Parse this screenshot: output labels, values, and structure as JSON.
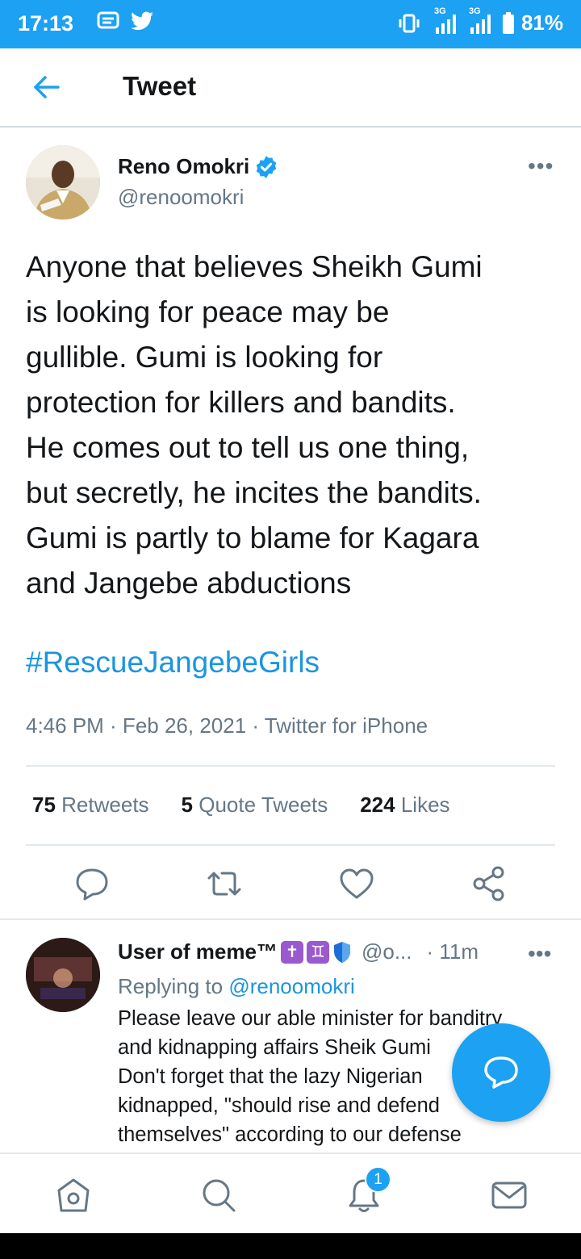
{
  "status_bar": {
    "time": "17:13",
    "battery": "81%",
    "network_1": "3G",
    "network_2": "3G"
  },
  "header": {
    "title": "Tweet"
  },
  "tweet": {
    "author_name": "Reno Omokri",
    "author_handle": "@renoomokri",
    "verified": true,
    "text": "Anyone that believes Sheikh Gumi\nis looking for peace may be\ngullible. Gumi is looking for\nprotection for killers and bandits.\nHe comes out to tell us one thing,\nbut secretly, he incites the bandits.\nGumi is partly to blame for Kagara\nand Jangebe abductions",
    "hashtag": "#RescueJangebeGirls",
    "meta": "4:46 PM · Feb 26, 2021 · Twitter for iPhone",
    "stats": {
      "retweets_count": "75",
      "retweets_label": "Retweets",
      "quotes_count": "5",
      "quotes_label": "Quote Tweets",
      "likes_count": "224",
      "likes_label": "Likes"
    }
  },
  "reply": {
    "author_name": "User of meme™",
    "handle": "@o...",
    "time": "· 11m",
    "replying_prefix": "Replying to",
    "replying_to": "@renoomokri",
    "text": "Please leave our able minister for banditry\nand kidnapping affairs Sheik Gumi\nDon't forget that the lazy Nigerian\nkidnapped, \"should rise and defend\nthemselves\" according to our defense"
  },
  "bottom_nav": {
    "notification_count": "1"
  },
  "colors": {
    "accent": "#1da1f2",
    "link": "#1b95e0",
    "muted": "#657786"
  }
}
